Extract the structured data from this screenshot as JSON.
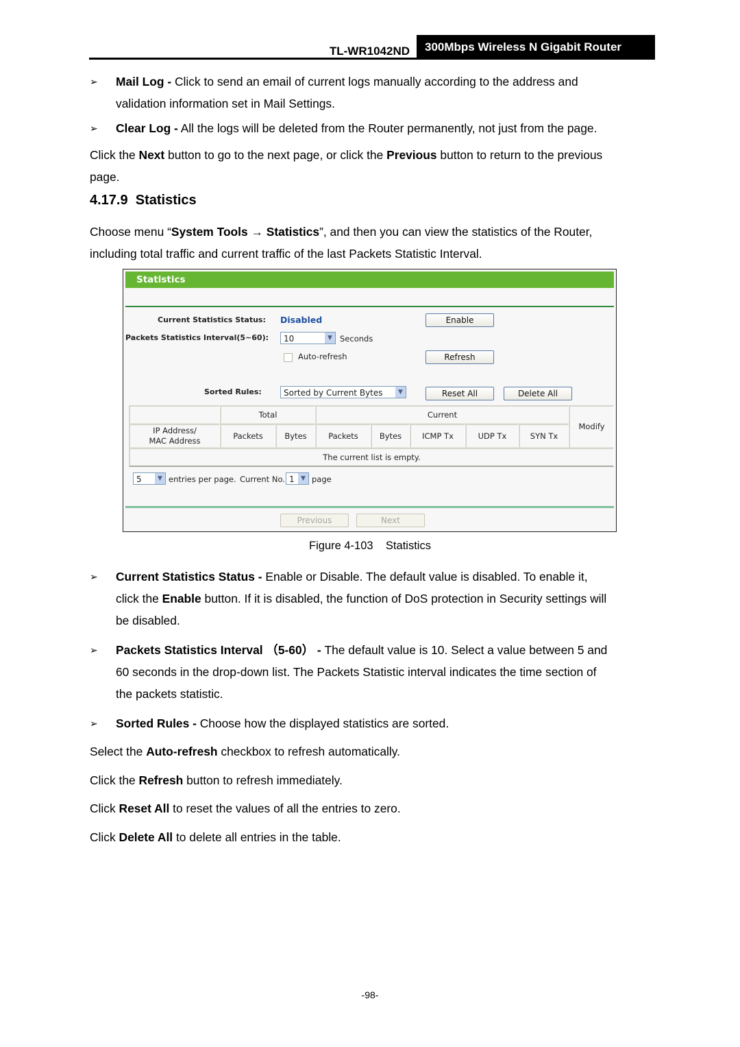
{
  "header": {
    "model": "TL-WR1042ND",
    "product": "300Mbps Wireless N Gigabit Router"
  },
  "intro_bullets": [
    {
      "term": "Mail Log -",
      "text_line1": " Click to send an email of current logs manually according to the address and",
      "text_line2": "validation information set in Mail Settings."
    },
    {
      "term": "Clear Log -",
      "text": " All the logs will be deleted from the Router permanently, not just from the page."
    }
  ],
  "nav_para": {
    "p1": "Click the ",
    "b1": "Next",
    "p2": " button to go to the next page, or click the ",
    "b2": "Previous",
    "p3": " button to return to the previous",
    "line2": "page."
  },
  "section": {
    "number": "4.17.9",
    "title": "Statistics",
    "intro": {
      "p1": "Choose menu “",
      "b1": "System Tools",
      "arrow": " → ",
      "b2": "Statistics",
      "p2": "”, and then you can view the statistics of the Router,",
      "line2": "including total traffic and current traffic of the last Packets Statistic Interval."
    }
  },
  "figure": {
    "panel_title": "Statistics",
    "current_status_label": "Current Statistics Status:",
    "current_status_value": "Disabled",
    "enable_button": "Enable",
    "interval_label": "Packets Statistics Interval(5~60):",
    "interval_value": "10",
    "interval_unit": "Seconds",
    "auto_refresh_label": "Auto-refresh",
    "auto_refresh_checked": false,
    "refresh_button": "Refresh",
    "sorted_rules_label": "Sorted Rules:",
    "sorted_rules_value": "Sorted by Current Bytes",
    "reset_all_button": "Reset All",
    "delete_all_button": "Delete All",
    "table": {
      "group_total": "Total",
      "group_current": "Current",
      "col_address_line1": "IP Address/",
      "col_address_line2": "MAC Address",
      "columns": [
        "Packets",
        "Bytes",
        "Packets",
        "Bytes",
        "ICMP Tx",
        "UDP Tx",
        "SYN Tx"
      ],
      "col_modify": "Modify",
      "empty_message": "The current list is empty."
    },
    "entries_per_page_value": "5",
    "entries_per_page_label": "entries per page.",
    "current_no_label": "Current No.",
    "current_page_value": "1",
    "page_label": "page",
    "previous_button": "Previous",
    "next_button": "Next"
  },
  "caption": "Figure 4-103    Statistics",
  "desc_bullets": [
    {
      "term": "Current Statistics Status -",
      "line1": " Enable or Disable. The default value is disabled. To enable it,",
      "l2a": "click the ",
      "l2b": "Enable",
      "l2c": " button. If it is disabled, the function of DoS protection in Security settings will",
      "line3": "be disabled."
    },
    {
      "term": "Packets Statistics Interval （5-60） -",
      "line1": " The default value is 10. Select a value between 5 and",
      "line2": "60 seconds in the drop-down list. The Packets Statistic interval indicates the time section of",
      "line3": "the packets statistic."
    },
    {
      "term": "Sorted Rules -",
      "line1": " Choose how the displayed statistics are sorted."
    }
  ],
  "closing": [
    {
      "p1": "Select the ",
      "b": "Auto-refresh",
      "p2": " checkbox to refresh automatically."
    },
    {
      "p1": "Click the ",
      "b": "Refresh",
      "p2": " button to refresh immediately."
    },
    {
      "p1": "Click ",
      "b": "Reset All",
      "p2": " to reset the values of all the entries to zero."
    },
    {
      "p1": "Click ",
      "b": "Delete All",
      "p2": " to delete all entries in the table."
    }
  ],
  "bullet_glyph": "➢",
  "page_number": "-98-"
}
